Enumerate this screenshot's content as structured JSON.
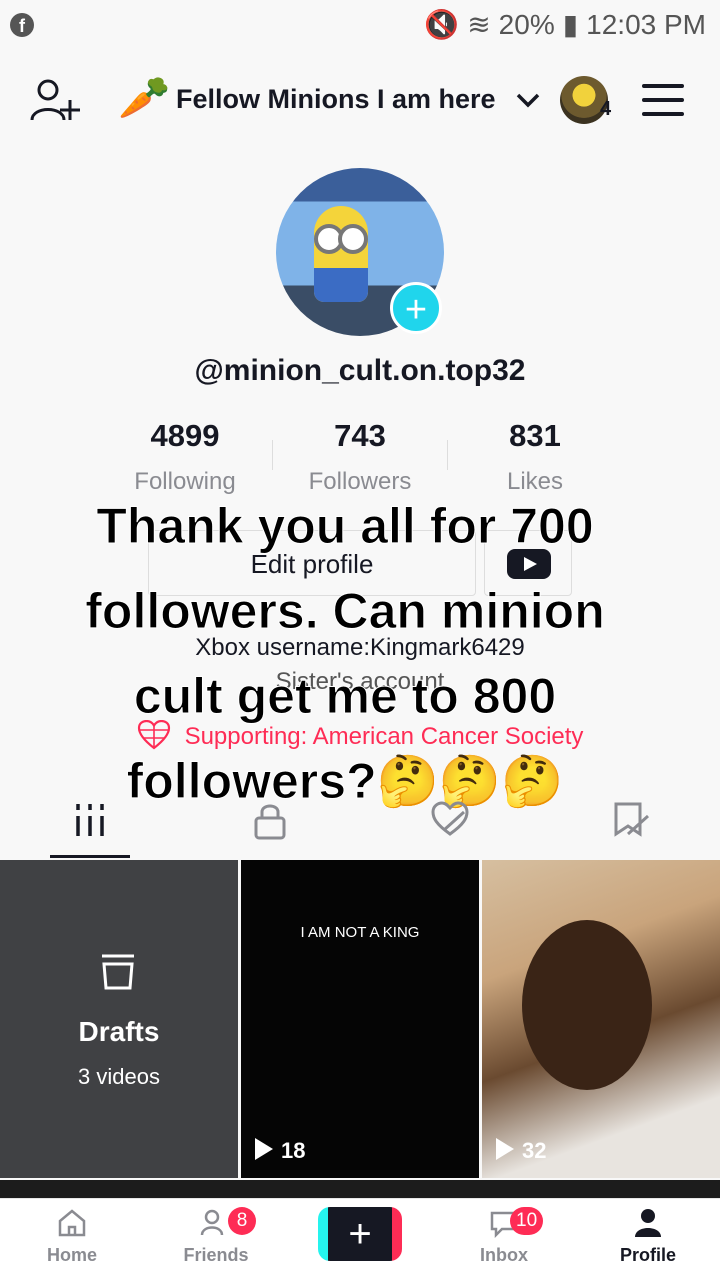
{
  "status_bar": {
    "battery": "20%",
    "time": "12:03 PM"
  },
  "header": {
    "account_name": "Fellow Minions I am here",
    "account_count": "4"
  },
  "profile": {
    "username": "@minion_cult.on.top32",
    "stats": [
      {
        "value": "4899",
        "label": "Following"
      },
      {
        "value": "743",
        "label": "Followers"
      },
      {
        "value": "831",
        "label": "Likes"
      }
    ],
    "edit_label": "Edit profile",
    "bio": "Xbox username:Kingmark6429",
    "bio_line2": "Sister's account",
    "support": "Supporting: American Cancer Society"
  },
  "overlay_caption": "Thank you all for 700 followers. Can minion cult get me to 800 followers?🤔🤔🤔",
  "grid": {
    "drafts_label": "Drafts",
    "drafts_count": "3 videos",
    "king_text": "I AM NOT A KING",
    "plays_1": "18",
    "plays_2": "32"
  },
  "nav": {
    "home": "Home",
    "friends": "Friends",
    "friends_badge": "8",
    "inbox": "Inbox",
    "inbox_badge": "10",
    "profile": "Profile"
  },
  "colors": {
    "accent": "#fe2c55",
    "cyan": "#20d5ec",
    "text": "#161823"
  }
}
